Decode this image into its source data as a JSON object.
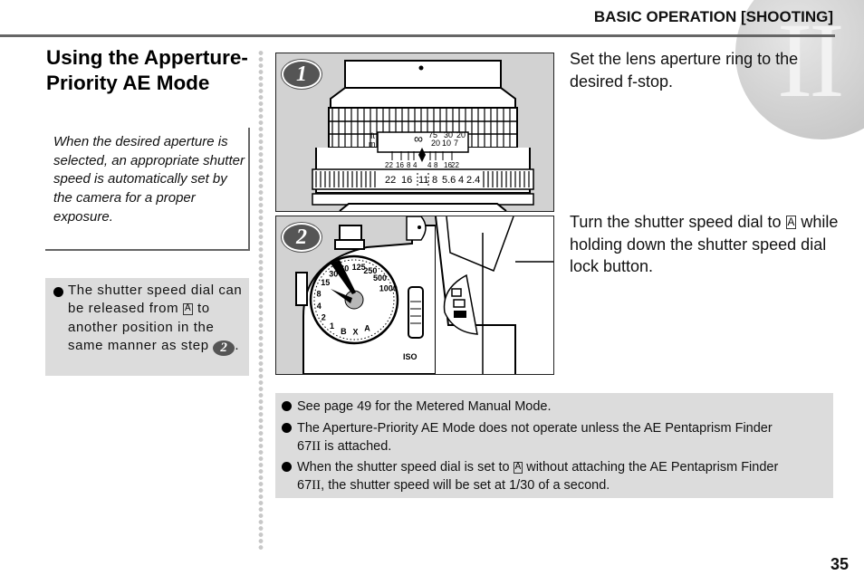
{
  "header": {
    "section_title": "BASIC OPERATION [SHOOTING]",
    "chapter_numeral": "II"
  },
  "page_title": "Using the Apperture-Priority AE Mode",
  "intro": "When the desired aperture is selected, an appropriate shutter speed is automatically set by the camera for a proper exposure.",
  "side_note": {
    "before_symbol": "The shutter speed dial can be released from",
    "symbol": "A",
    "after_symbol": "to another position in the same manner as step",
    "step_ref": "2",
    "end": "."
  },
  "steps": [
    {
      "number": "1",
      "text": "Set the lens aperture ring to the desired f-stop.",
      "figure": {
        "description": "lens-aperture-ring-illustration",
        "distance_scale": {
          "ft_label": "ft",
          "m_label": "m",
          "infinity": "∞",
          "ft_values": [
            "75",
            "30",
            "20"
          ],
          "m_values": [
            "20",
            "10",
            "7"
          ]
        },
        "dof_scale": [
          "22",
          "16",
          "8",
          "4",
          "4",
          "8",
          "16",
          "22"
        ],
        "aperture_scale": [
          "22",
          "16",
          "11",
          "8",
          "5.6",
          "4",
          "2.4"
        ]
      }
    },
    {
      "number": "2",
      "text_before": "Turn the shutter speed dial to",
      "symbol": "A",
      "text_after": "while holding down the shutter speed dial lock button.",
      "figure": {
        "description": "shutter-speed-dial-illustration",
        "dial_values": [
          "1000",
          "500",
          "250",
          "125",
          "60",
          "30",
          "15",
          "8",
          "4",
          "2",
          "1",
          "B",
          "X",
          "A"
        ],
        "iso_label": "ISO"
      }
    }
  ],
  "notes": [
    {
      "text": "See page 49 for the Metered Manual Mode."
    },
    {
      "line1": "The Aperture-Priority AE Mode does not operate unless the AE Pentaprism Finder",
      "line2_num": "67",
      "line2_roman": "II",
      "line2_rest": " is attached."
    },
    {
      "line1_before": "When the shutter speed dial is set to",
      "symbol": "A",
      "line1_after": "without attaching the AE Pentaprism Finder",
      "line2_num": "67",
      "line2_roman": "II",
      "line2_rest": ", the shutter speed will be set at 1/30 of a second."
    }
  ],
  "page_number": "35"
}
